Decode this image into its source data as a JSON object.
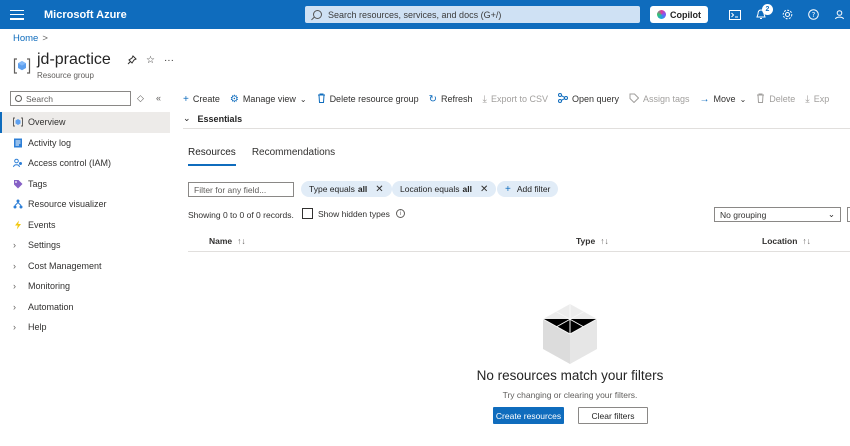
{
  "topbar": {
    "brand": "Microsoft Azure",
    "search_placeholder": "Search resources, services, and docs (G+/)",
    "copilot_label": "Copilot",
    "notification_count": "2",
    "icons": [
      "cloud-shell-icon",
      "notifications-icon",
      "settings-icon",
      "help-icon",
      "feedback-icon"
    ]
  },
  "breadcrumb": {
    "home": "Home",
    "separator": ">"
  },
  "header": {
    "title": "jd-practice",
    "subtitle": "Resource group",
    "more": "···"
  },
  "sidebar": {
    "search_placeholder": "Search",
    "items": [
      {
        "label": "Overview",
        "icon": "overview-icon",
        "active": true
      },
      {
        "label": "Activity log",
        "icon": "activity-log-icon"
      },
      {
        "label": "Access control (IAM)",
        "icon": "iam-icon"
      },
      {
        "label": "Tags",
        "icon": "tag-icon"
      },
      {
        "label": "Resource visualizer",
        "icon": "visualizer-icon"
      },
      {
        "label": "Events",
        "icon": "events-icon"
      },
      {
        "label": "Settings",
        "expandable": true
      },
      {
        "label": "Cost Management",
        "expandable": true
      },
      {
        "label": "Monitoring",
        "expandable": true
      },
      {
        "label": "Automation",
        "expandable": true
      },
      {
        "label": "Help",
        "expandable": true
      }
    ]
  },
  "toolbar": {
    "create": "Create",
    "manage_view": "Manage view",
    "delete_rg": "Delete resource group",
    "refresh": "Refresh",
    "export_csv": "Export to CSV",
    "open_query": "Open query",
    "assign_tags": "Assign tags",
    "move": "Move",
    "delete": "Delete",
    "export": "Exp"
  },
  "essentials": {
    "label": "Essentials"
  },
  "tabs": [
    "Resources",
    "Recommendations"
  ],
  "filters": {
    "input_placeholder": "Filter for any field...",
    "type_pill_prefix": "Type equals",
    "type_pill_value": "all",
    "location_pill_prefix": "Location equals",
    "location_pill_value": "all",
    "add_filter": "Add filter"
  },
  "records": {
    "summary": "Showing 0 to 0 of 0 records.",
    "show_hidden": "Show hidden types",
    "grouping": "No grouping"
  },
  "table": {
    "columns": [
      "Name",
      "Type",
      "Location"
    ]
  },
  "empty_state": {
    "title": "No resources match your filters",
    "subtitle": "Try changing or clearing your filters.",
    "primary_button": "Create resources",
    "secondary_button": "Clear filters"
  },
  "colors": {
    "accent": "#0f6cbd",
    "topbar": "#0f6cbd"
  }
}
